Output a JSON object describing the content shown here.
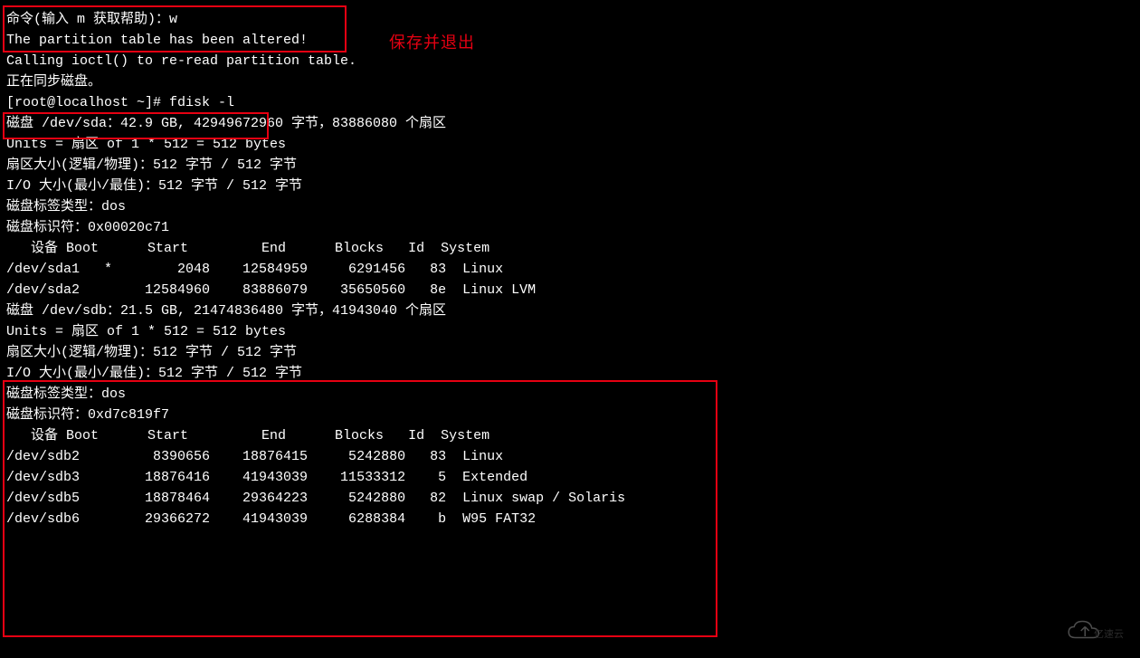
{
  "annotation_save_exit": "保存并退出",
  "lines": {
    "l1": "命令(输入 m 获取帮助)：w",
    "l2": "The partition table has been altered!",
    "l3": "",
    "l4": "Calling ioctl() to re-read partition table.",
    "l5": "正在同步磁盘。",
    "l6": "[root@localhost ~]# fdisk -l",
    "l7": "",
    "l8": "磁盘 /dev/sda：42.9 GB, 42949672960 字节，83886080 个扇区",
    "l9": "Units = 扇区 of 1 * 512 = 512 bytes",
    "l10": "扇区大小(逻辑/物理)：512 字节 / 512 字节",
    "l11": "I/O 大小(最小/最佳)：512 字节 / 512 字节",
    "l12": "磁盘标签类型：dos",
    "l13": "磁盘标识符：0x00020c71",
    "l14": "",
    "l15": "   设备 Boot      Start         End      Blocks   Id  System",
    "l16": "/dev/sda1   *        2048    12584959     6291456   83  Linux",
    "l17": "/dev/sda2        12584960    83886079    35650560   8e  Linux LVM",
    "l18": "",
    "l19": "磁盘 /dev/sdb：21.5 GB, 21474836480 字节，41943040 个扇区",
    "l20": "Units = 扇区 of 1 * 512 = 512 bytes",
    "l21": "扇区大小(逻辑/物理)：512 字节 / 512 字节",
    "l22": "I/O 大小(最小/最佳)：512 字节 / 512 字节",
    "l23": "磁盘标签类型：dos",
    "l24": "磁盘标识符：0xd7c819f7",
    "l25": "",
    "l26": "   设备 Boot      Start         End      Blocks   Id  System",
    "l27": "/dev/sdb2         8390656    18876415     5242880   83  Linux",
    "l28": "/dev/sdb3        18876416    41943039    11533312    5  Extended",
    "l29": "/dev/sdb5        18878464    29364223     5242880   82  Linux swap / Solaris",
    "l30": "/dev/sdb6        29366272    41943039     6288384    b  W95 FAT32"
  },
  "watermark_text": "亿速云"
}
